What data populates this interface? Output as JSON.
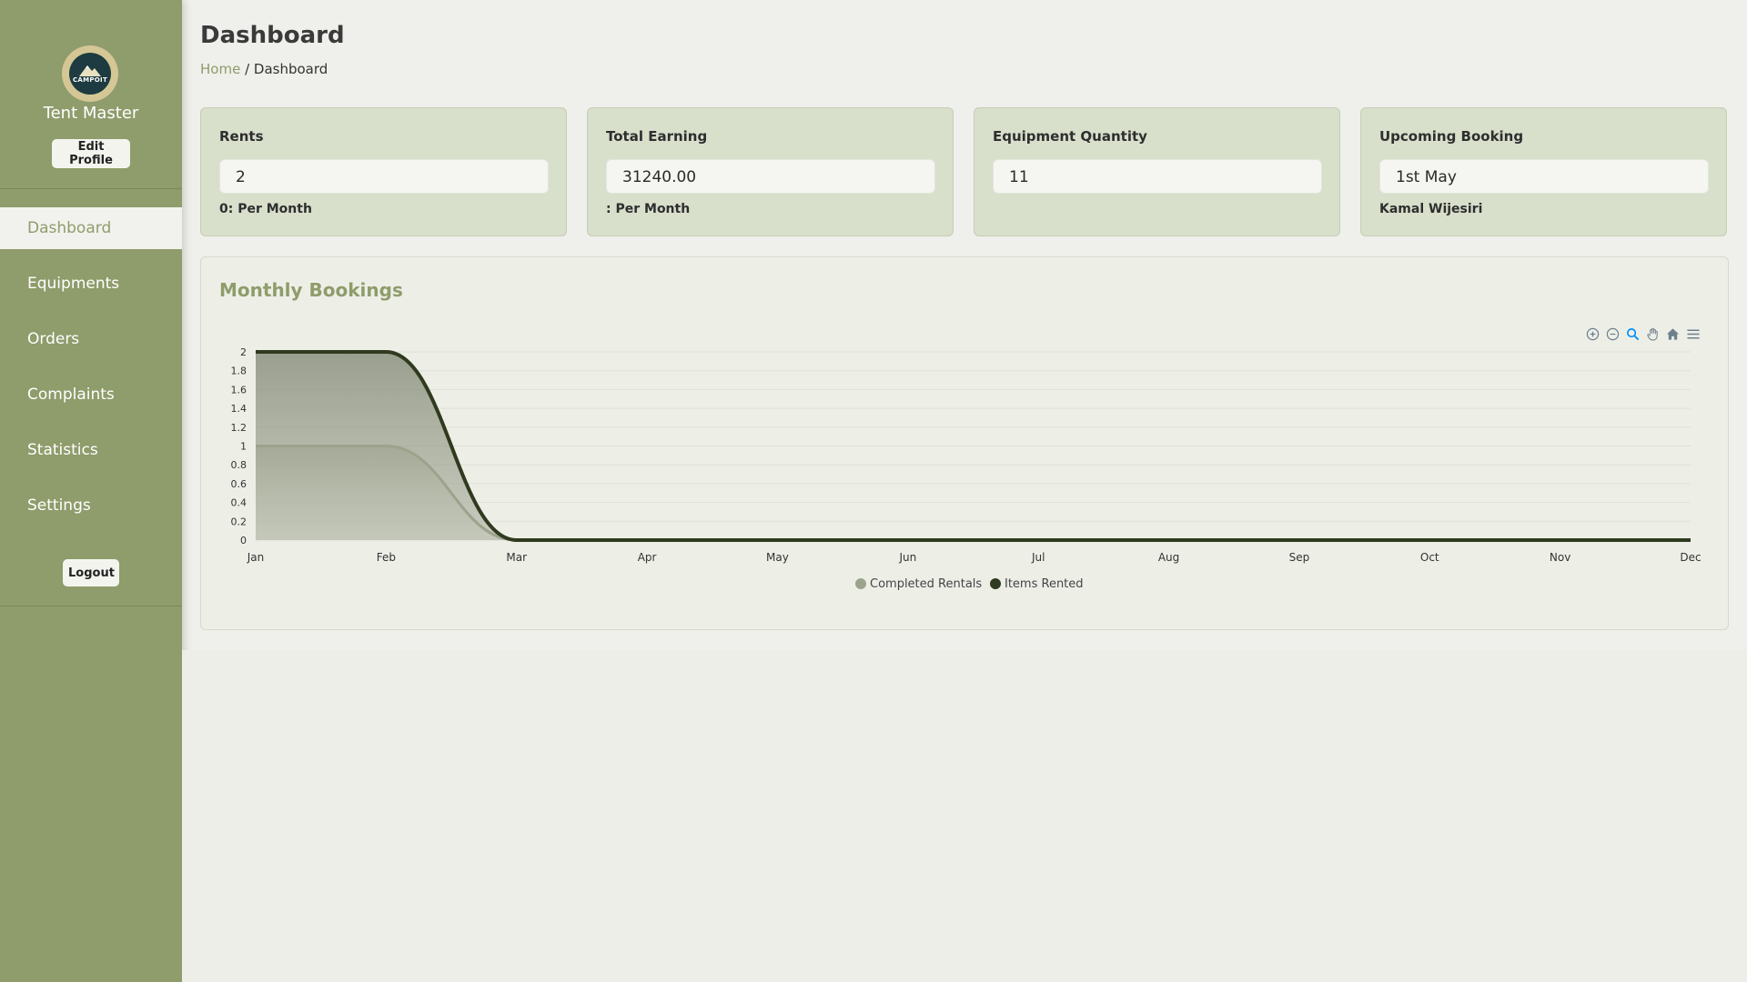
{
  "sidebar": {
    "logo_text": "CAMPOIT",
    "profile_name": "Tent Master",
    "edit_profile_label": "Edit Profile",
    "items": [
      {
        "label": "Dashboard",
        "active": true
      },
      {
        "label": "Equipments"
      },
      {
        "label": "Orders"
      },
      {
        "label": "Complaints"
      },
      {
        "label": "Statistics"
      },
      {
        "label": "Settings"
      }
    ],
    "logout_label": "Logout"
  },
  "header": {
    "title": "Dashboard",
    "breadcrumb_home": "Home",
    "breadcrumb_sep": "/",
    "breadcrumb_current": "Dashboard"
  },
  "cards": [
    {
      "title": "Rents",
      "value": "2",
      "sub": "0: Per Month"
    },
    {
      "title": "Total Earning",
      "value": "31240.00",
      "sub": ": Per Month"
    },
    {
      "title": "Equipment Quantity",
      "value": "11",
      "sub": ""
    },
    {
      "title": "Upcoming Booking",
      "value": "1st May",
      "sub": "Kamal Wijesiri"
    }
  ],
  "chart_panel": {
    "title": "Monthly Bookings",
    "toolbar_icons": [
      "zoom-in-icon",
      "zoom-out-icon",
      "zoom-selection-icon",
      "pan-icon",
      "reset-home-icon",
      "menu-icon"
    ]
  },
  "colors": {
    "sidebar": "#8f9c6b",
    "accent": "#8f9c6b",
    "series_completed": "#9ca38c",
    "series_items": "#2f3a1e"
  },
  "chart_data": {
    "type": "area",
    "title": "Monthly Bookings",
    "categories": [
      "Jan",
      "Feb",
      "Mar",
      "Apr",
      "May",
      "Jun",
      "Jul",
      "Aug",
      "Sep",
      "Oct",
      "Nov",
      "Dec"
    ],
    "series": [
      {
        "name": "Completed Rentals",
        "values": [
          1,
          1,
          0,
          0,
          0,
          0,
          0,
          0,
          0,
          0,
          0,
          0
        ]
      },
      {
        "name": "Items Rented",
        "values": [
          2,
          2,
          0,
          0,
          0,
          0,
          0,
          0,
          0,
          0,
          0,
          0
        ]
      }
    ],
    "ylim": [
      0,
      2
    ],
    "yticks": [
      "0",
      "0.2",
      "0.4",
      "0.6",
      "0.8",
      "1",
      "1.2",
      "1.4",
      "1.6",
      "1.8",
      "2"
    ],
    "grid": true,
    "legend": "bottom-center",
    "xlabel": "",
    "ylabel": ""
  }
}
